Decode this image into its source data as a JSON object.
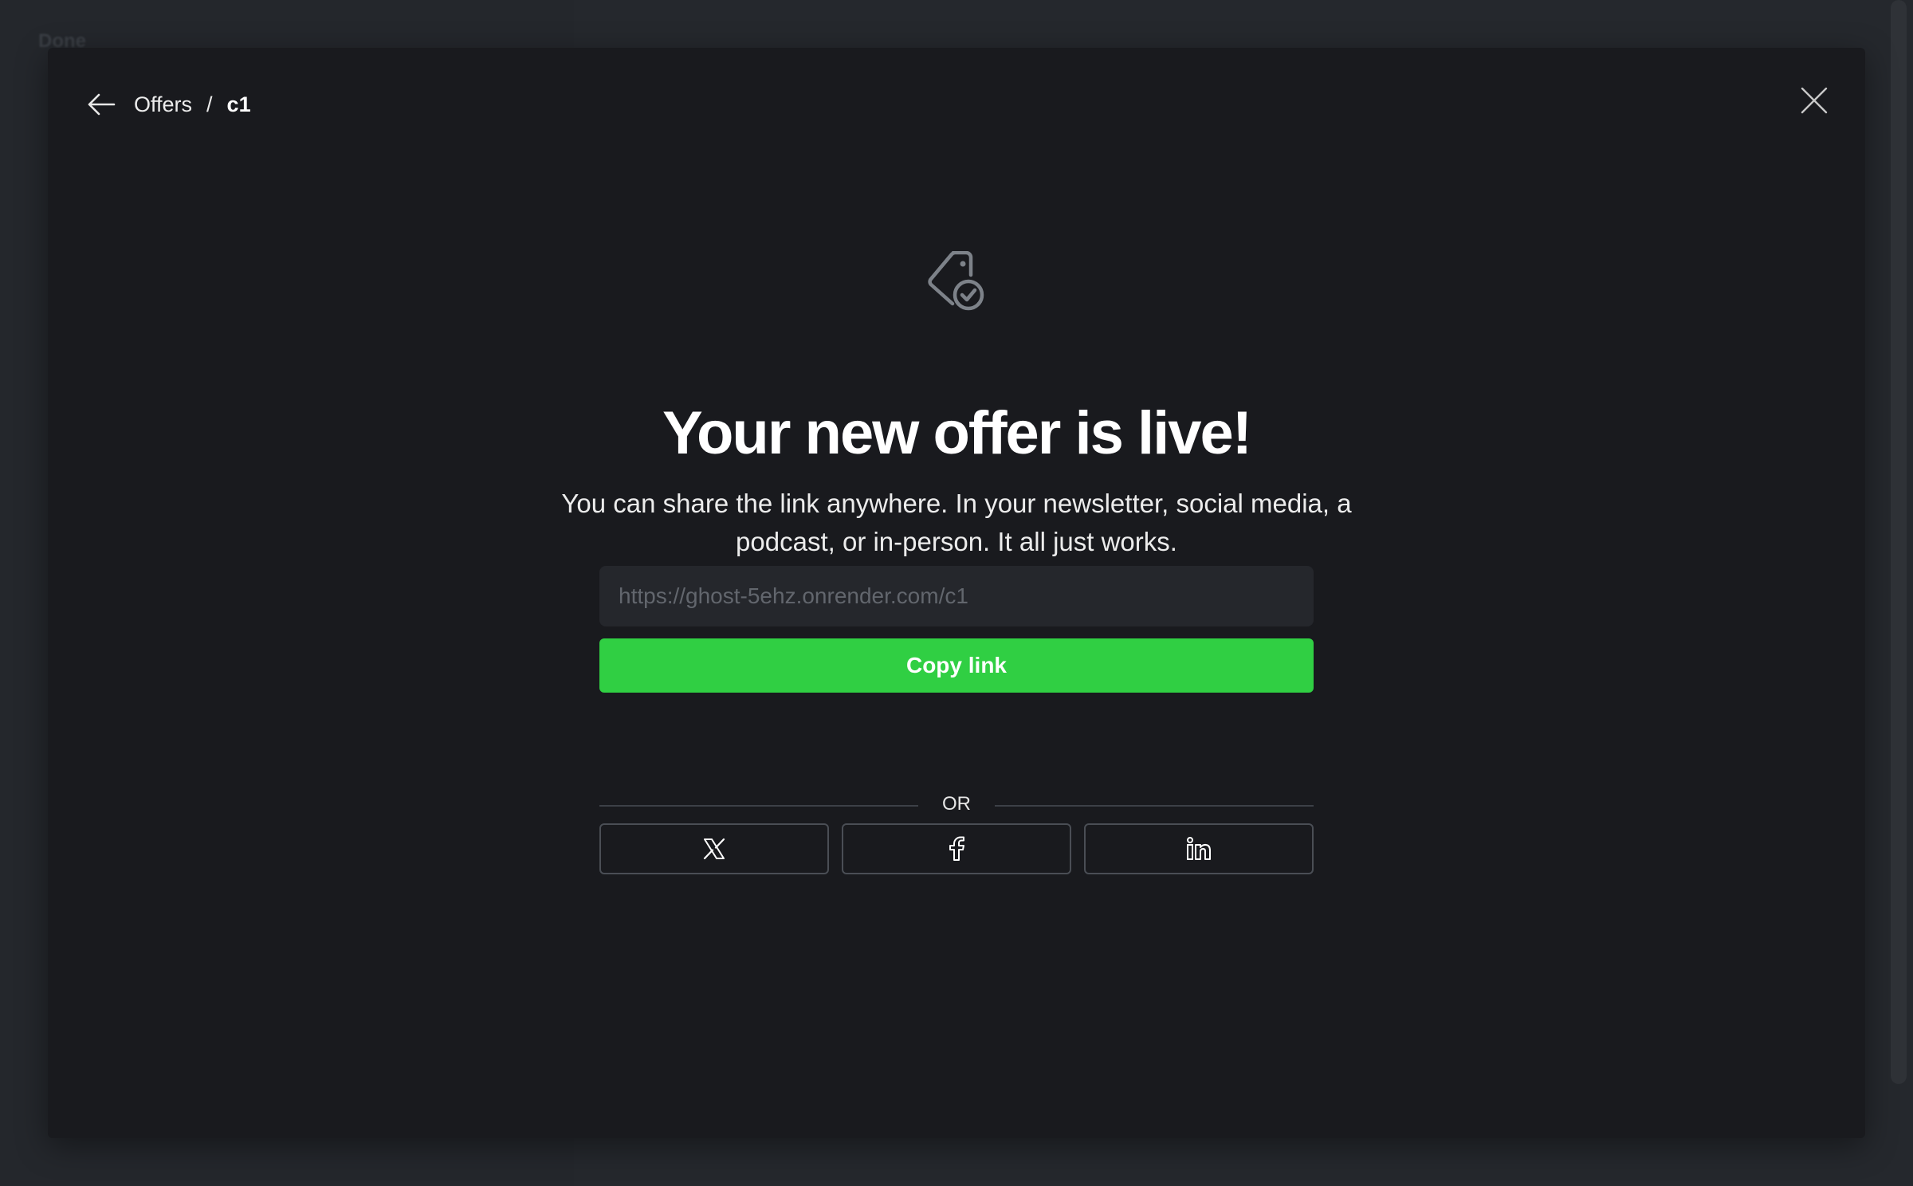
{
  "background": {
    "label": "Done"
  },
  "breadcrumb": {
    "parent_label": "Offers",
    "separator": "/",
    "current_label": "c1"
  },
  "hero": {
    "icon": "tag-check-icon",
    "title": "Your new offer is live!",
    "description": "You can share the link anywhere. In your newsletter, social media, a podcast, or in-person. It all just works."
  },
  "share": {
    "url_placeholder": "https://ghost-5ehz.onrender.com/c1",
    "copy_label": "Copy link",
    "divider_label": "OR",
    "buttons": [
      {
        "icon": "x-twitter-icon"
      },
      {
        "icon": "facebook-icon"
      },
      {
        "icon": "linkedin-icon"
      }
    ]
  },
  "colors": {
    "accent": "#30cf43",
    "modal_bg": "#191a1e",
    "text": "#ffffff"
  }
}
